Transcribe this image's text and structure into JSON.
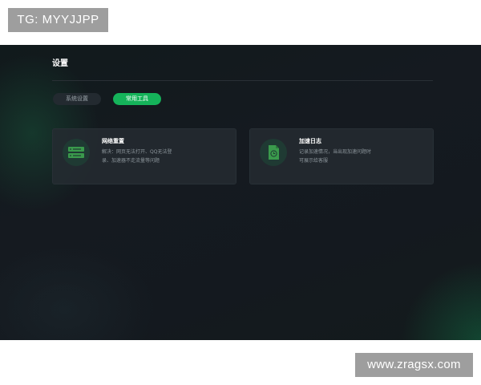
{
  "watermarks": {
    "top_left": "TG: MYYJJPP",
    "bottom_right": "www.zragsx.com"
  },
  "page": {
    "title": "设置"
  },
  "tabs": [
    {
      "label": "系统设置",
      "active": false
    },
    {
      "label": "常用工具",
      "active": true
    }
  ],
  "tools": [
    {
      "title": "网络重置",
      "desc_line1": "解决：网页无法打开、QQ无法登",
      "desc_line2": "录、加速器不走流量等问题",
      "icon": "server-reset-icon"
    },
    {
      "title": "加速日志",
      "desc_line1": "记录加速情况，当出现加速问题时",
      "desc_line2": "可展示给客服",
      "icon": "log-file-icon"
    }
  ],
  "colors": {
    "accent": "#15b35a",
    "background": "#14191f",
    "card": "#242b31",
    "icon_bg": "#1f3a33",
    "icon_fg": "#3a9a4c"
  }
}
